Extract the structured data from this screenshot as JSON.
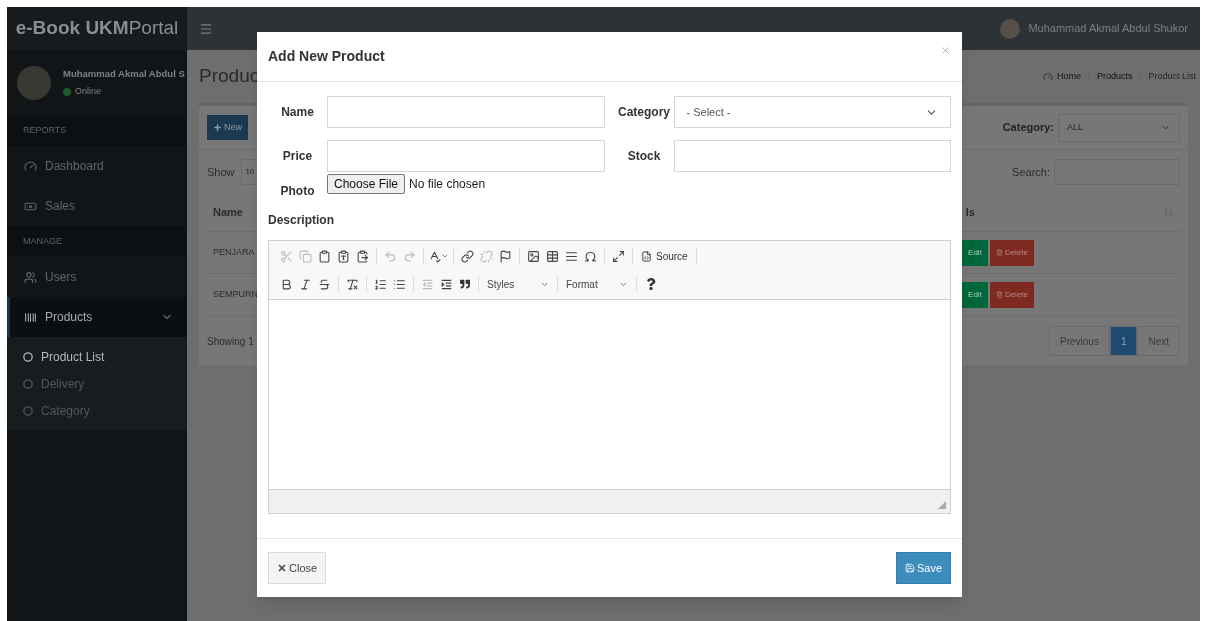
{
  "app": {
    "brand": "**e-Book UKM**Portal"
  },
  "header": {
    "user_name": "Muhammad Akmal Abdul Shukor"
  },
  "sidebar": {
    "user": {
      "name": "Muhammad Akmal Abdul S",
      "status": "Online"
    },
    "sections": [
      {
        "title": "REPORTS",
        "items": [
          {
            "label": "Dashboard",
            "selected": false
          },
          {
            "label": "Sales",
            "selected": false
          }
        ]
      },
      {
        "title": "MANAGE",
        "items": [
          {
            "label": "Users",
            "selected": false
          },
          {
            "label": "Products",
            "selected": true,
            "expanded": true,
            "children": [
              {
                "label": "Product List",
                "selected": true
              },
              {
                "label": "Delivery",
                "selected": false
              },
              {
                "label": "Category",
                "selected": false
              }
            ]
          }
        ]
      }
    ]
  },
  "page": {
    "title": "Produc",
    "breadcrumb": [
      "Home",
      "Products",
      "Product List"
    ],
    "new_button": "New",
    "category_filter": {
      "label": "Category:",
      "value": "ALL"
    },
    "show_label": "Show",
    "page_length": "10",
    "search_label": "Search:",
    "table": {
      "columns": [
        "Name",
        "ls"
      ],
      "rows": [
        {
          "name": "PENJARA",
          "actions": [
            "Edit",
            "Delete"
          ]
        },
        {
          "name": "SEMPURN",
          "actions": [
            "Edit",
            "Delete"
          ]
        }
      ]
    },
    "info": "Showing 1",
    "pagination": [
      {
        "label": "Previous",
        "selected": false
      },
      {
        "label": "1",
        "selected": true
      },
      {
        "label": "Next",
        "selected": false
      }
    ]
  },
  "modal": {
    "title": "Add New Product",
    "fields": [
      {
        "label": "Name",
        "kind": "text"
      },
      {
        "label": "Category",
        "kind": "select",
        "value": "- Select -"
      },
      {
        "label": "Price",
        "kind": "text"
      },
      {
        "label": "Stock",
        "kind": "text"
      }
    ],
    "photo": {
      "label": "Photo",
      "button": "Choose File",
      "status": "No file chosen"
    },
    "description": {
      "label": "Description",
      "source_button": "Source",
      "styles": "Styles",
      "format": "Format"
    },
    "buttons": [
      {
        "label": "Close",
        "kind": "close"
      },
      {
        "label": "Save",
        "kind": "save"
      }
    ]
  }
}
